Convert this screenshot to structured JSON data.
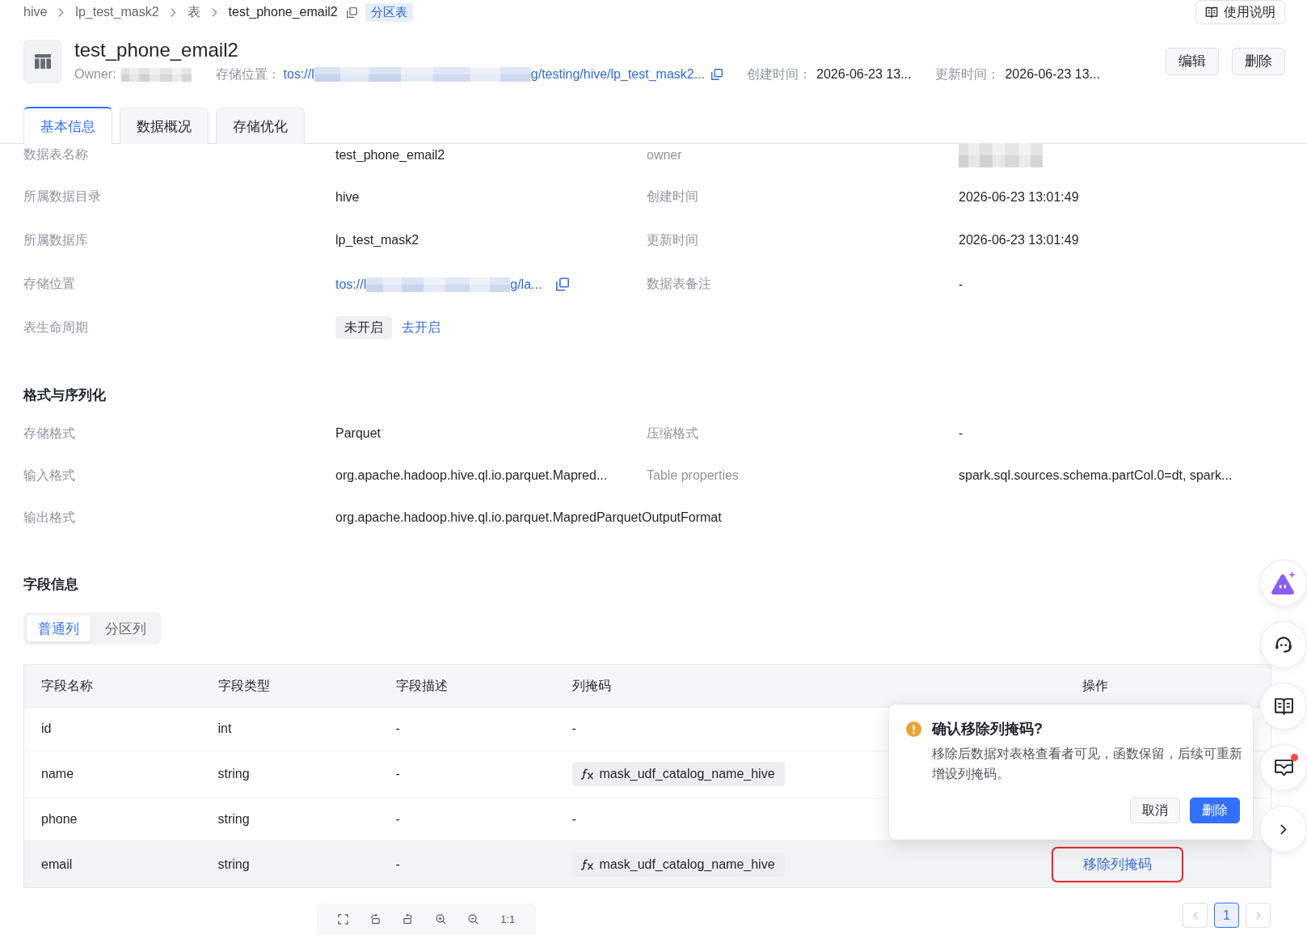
{
  "breadcrumb": {
    "items": [
      {
        "label": "hive",
        "current": false
      },
      {
        "label": "lp_test_mask2",
        "current": false
      },
      {
        "label": "表",
        "current": false
      },
      {
        "label": "test_phone_email2",
        "current": true
      }
    ],
    "copyable": true,
    "tag": "分区表"
  },
  "help_button": {
    "label": "使用说明"
  },
  "header": {
    "title": "test_phone_email2",
    "meta": [
      {
        "kind": "redacted",
        "label": "Owner:"
      },
      {
        "kind": "link",
        "label": "存储位置：",
        "segments": [
          {
            "kind": "text",
            "text": "tos://l"
          },
          {
            "kind": "redacted"
          },
          {
            "kind": "text",
            "text": "g/testing/hive/lp_test_mask2..."
          }
        ],
        "copyable": true
      },
      {
        "kind": "text",
        "label": "创建时间：",
        "value": "2026-06-23 13..."
      },
      {
        "kind": "text",
        "label": "更新时间：",
        "value": "2026-06-23 13..."
      }
    ],
    "actions": [
      {
        "label": "编辑"
      },
      {
        "label": "删除"
      }
    ]
  },
  "tabs": [
    {
      "label": "基本信息",
      "selected": true
    },
    {
      "label": "数据概况",
      "selected": false
    },
    {
      "label": "存储优化",
      "selected": false
    }
  ],
  "basic_info": {
    "fields": [
      {
        "label": "数据表名称",
        "kind": "text",
        "value": "test_phone_email2"
      },
      {
        "label": "owner",
        "kind": "redacted"
      },
      {
        "label": "所属数据目录",
        "kind": "text",
        "value": "hive"
      },
      {
        "label": "创建时间",
        "kind": "text",
        "value": "2026-06-23 13:01:49"
      },
      {
        "label": "所属数据库",
        "kind": "text",
        "value": "lp_test_mask2"
      },
      {
        "label": "更新时间",
        "kind": "text",
        "value": "2026-06-23 13:01:49"
      },
      {
        "label": "存储位置",
        "kind": "link",
        "segments": [
          {
            "kind": "text",
            "text": "tos://l"
          },
          {
            "kind": "redacted"
          },
          {
            "kind": "text",
            "text": "g/la..."
          }
        ],
        "copyable": true
      },
      {
        "label": "数据表备注",
        "kind": "text",
        "value": "-"
      },
      {
        "label": "表生命周期",
        "kind": "status",
        "status": "未开启",
        "action": "去开启"
      }
    ]
  },
  "format_section": {
    "title": "格式与序列化",
    "fields": [
      {
        "label": "存储格式",
        "kind": "text",
        "value": "Parquet"
      },
      {
        "label": "压缩格式",
        "kind": "text",
        "value": "-"
      },
      {
        "label": "输入格式",
        "kind": "text",
        "value": "org.apache.hadoop.hive.ql.io.parquet.Mapred..."
      },
      {
        "label": "Table properties",
        "kind": "text",
        "value": "spark.sql.sources.schema.partCol.0=dt, spark..."
      },
      {
        "label": "输出格式",
        "kind": "text",
        "value": "org.apache.hadoop.hive.ql.io.parquet.MapredParquetOutputFormat"
      }
    ]
  },
  "fields_section": {
    "title": "字段信息",
    "column_tabs": [
      {
        "label": "普通列",
        "selected": true
      },
      {
        "label": "分区列",
        "selected": false
      }
    ],
    "table": {
      "columns": [
        "字段名称",
        "字段类型",
        "字段描述",
        "列掩码",
        "操作"
      ],
      "rows": [
        {
          "name": "id",
          "type": "int",
          "description": "-",
          "mask": {
            "kind": "text",
            "text": "-"
          },
          "hovered": false
        },
        {
          "name": "name",
          "type": "string",
          "description": "-",
          "mask": {
            "kind": "function",
            "text": "mask_udf_catalog_name_hive"
          },
          "hovered": false
        },
        {
          "name": "phone",
          "type": "string",
          "description": "-",
          "mask": {
            "kind": "text",
            "text": "-"
          },
          "hovered": false
        },
        {
          "name": "email",
          "type": "string",
          "description": "-",
          "mask": {
            "kind": "function",
            "text": "mask_udf_catalog_name_hive"
          },
          "hovered": true,
          "action": {
            "label": "移除列掩码",
            "highlighted": true
          }
        }
      ]
    },
    "pagination": {
      "prev_disabled": true,
      "pages": [
        {
          "label": "1",
          "selected": true
        }
      ],
      "next_disabled": true
    }
  },
  "confirm_popover": {
    "title": "确认移除列掩码?",
    "message": "移除后数据对表格查看者可见，函数保留，后续可重新增设列掩码。",
    "buttons": [
      {
        "label": "取消",
        "kind": "default"
      },
      {
        "label": "删除",
        "kind": "primary"
      }
    ]
  },
  "floating_actions": [
    {
      "kind": "assistant",
      "badge": false
    },
    {
      "kind": "support",
      "badge": false
    },
    {
      "kind": "docs",
      "badge": false
    },
    {
      "kind": "messages",
      "badge": true
    },
    {
      "kind": "collapse",
      "badge": false
    }
  ],
  "image_toolbar": {
    "actual_size_label": "1:1"
  }
}
